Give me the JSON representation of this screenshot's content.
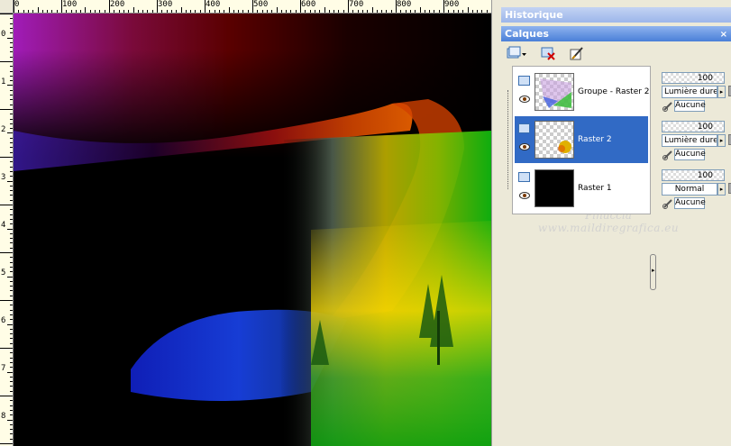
{
  "ruler": {
    "top_labels": [
      "0",
      "100",
      "200",
      "300",
      "400",
      "500",
      "600",
      "700",
      "800",
      "900"
    ],
    "left_labels": [
      "0",
      "1",
      "2",
      "3",
      "4",
      "5",
      "6",
      "7",
      "8"
    ]
  },
  "panels": {
    "historique": {
      "title": "Historique"
    },
    "calques": {
      "title": "Calques",
      "close_glyph": "×"
    }
  },
  "layers": [
    {
      "name": "Groupe - Raster 2",
      "opacity": "100",
      "blend": "Lumière dure",
      "mask": "Aucune",
      "selected": false
    },
    {
      "name": "Raster 2",
      "opacity": "100",
      "blend": "Lumière dure",
      "mask": "Aucune",
      "selected": true
    },
    {
      "name": "Raster 1",
      "opacity": "100",
      "blend": "Normal",
      "mask": "Aucune",
      "selected": false
    }
  ],
  "watermark": {
    "line1": "Pinuccia",
    "line2": "www.maildiregrafica.eu"
  },
  "icons": {
    "new_layer": "new-raster-layer-icon",
    "delete_layer": "delete-layer-icon",
    "properties": "layer-properties-icon",
    "visibility": "eye-icon",
    "link": "link-icon"
  },
  "colors": {
    "panel_title": "#4a7fd8",
    "selection": "#316ac5",
    "chrome": "#ece9d8"
  }
}
